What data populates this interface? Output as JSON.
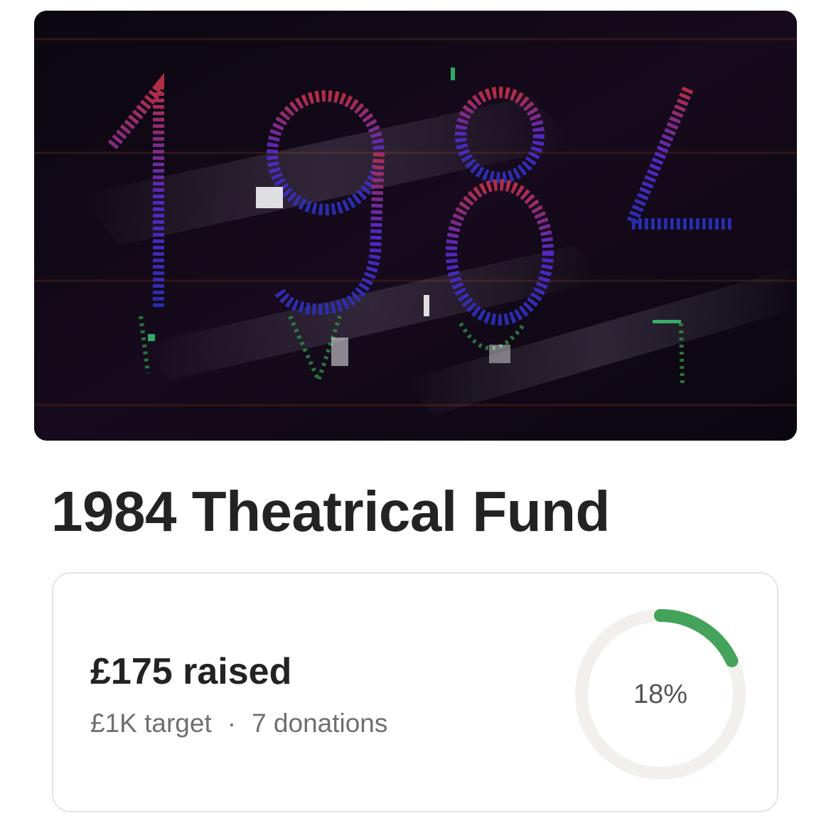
{
  "hero_image": {
    "alt_text": "1984"
  },
  "fundraiser": {
    "title": "1984 Theatrical Fund"
  },
  "progress": {
    "raised_label": "£175 raised",
    "target_label": "£1K target",
    "separator": "·",
    "donations_label": "7 donations",
    "percent_label": "18%",
    "percent_value": 18,
    "fill_color": "#43a35a",
    "track_color": "#f1f0ec"
  }
}
